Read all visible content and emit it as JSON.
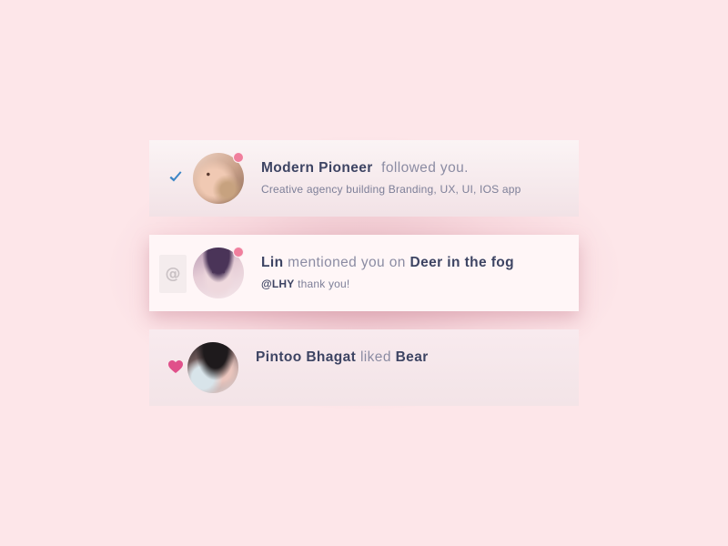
{
  "notifications": [
    {
      "status_icon": "checkmark-icon",
      "status_color": "#3d86c6",
      "avatar": "user-avatar-modern-pioneer",
      "unread": true,
      "actor": "Modern Pioneer",
      "action": "followed you.",
      "subtitle": "Creative agency building Branding, UX, UI, IOS app"
    },
    {
      "status_icon": "at-sign-icon",
      "status_glyph": "@",
      "status_color": "#c9c1c4",
      "avatar": "user-avatar-lin",
      "unread": true,
      "actor": "Lin",
      "action": "mentioned you on",
      "target": "Deer in the fog",
      "mention_handle": "@LHY",
      "message": "thank you!"
    },
    {
      "status_icon": "heart-icon",
      "status_color": "#e0508a",
      "avatar": "user-avatar-pintoo-bhagat",
      "unread": false,
      "actor": "Pintoo Bhagat",
      "action": "liked",
      "target": "Bear"
    }
  ],
  "colors": {
    "background": "#fde6e9",
    "text_strong": "#3d4463",
    "text_muted": "#8b8ca3",
    "unread_dot": "#f07f9d"
  }
}
